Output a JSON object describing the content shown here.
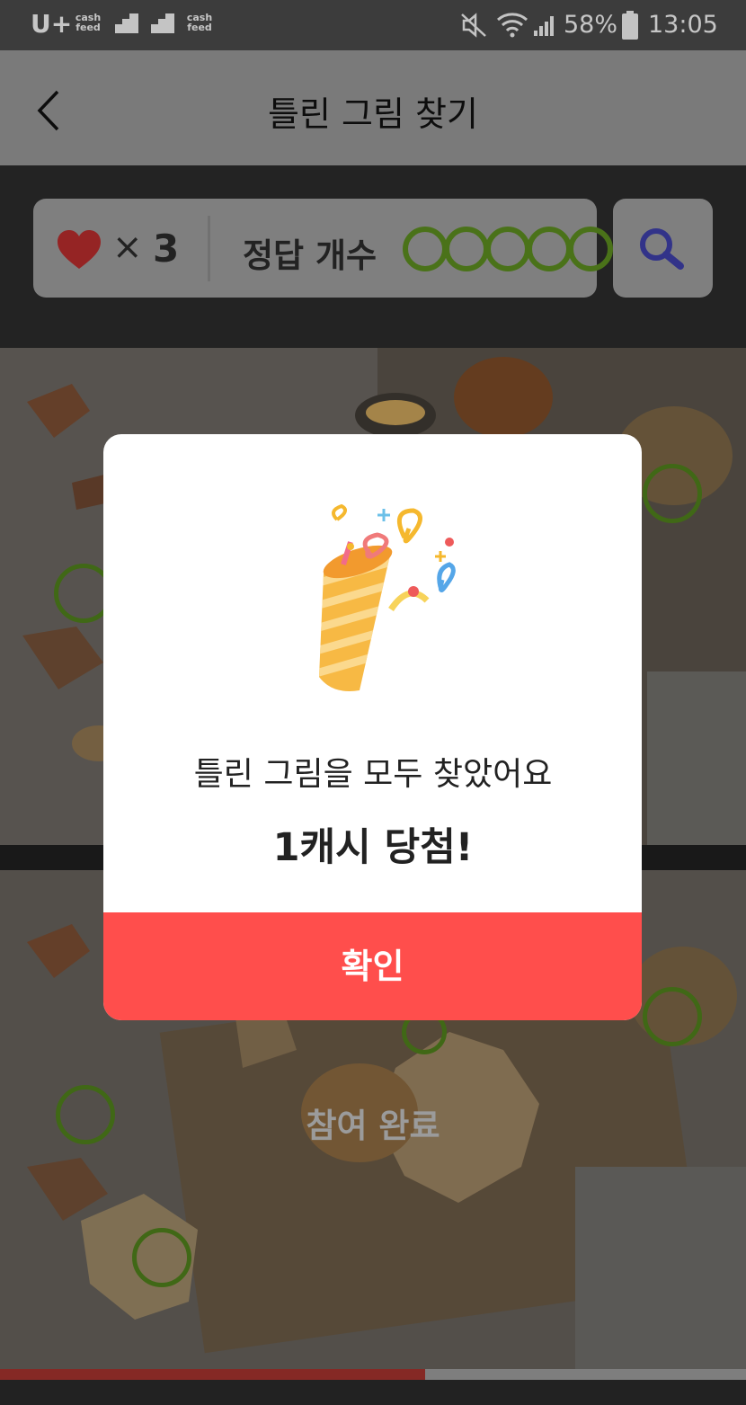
{
  "status_bar": {
    "carrier": "U+",
    "app_badge_1": "cash feed",
    "app_badge_2": "cash feed",
    "battery": "58%",
    "time": "13:05",
    "icons": [
      "mute-icon",
      "wifi-icon",
      "signal-icon",
      "battery-icon"
    ]
  },
  "header": {
    "title": "틀린 그림 찾기",
    "back_icon": "chevron-left-icon"
  },
  "game_status": {
    "lives_times": "×",
    "lives_count": "3",
    "answers_label": "정답 개수",
    "answers_found": 5,
    "answers_total": 5,
    "hint_icon": "search-icon",
    "ring_color": "#5b8c1f"
  },
  "photos": {
    "completed_label": "참여 완료"
  },
  "progress": {
    "fraction": 0.57,
    "fill_color": "#a3332e"
  },
  "modal": {
    "illustration": "party-popper-icon",
    "message": "틀린 그림을 모두 찾았어요",
    "prize": "1캐시 당첨!",
    "confirm_label": "확인",
    "confirm_color": "#ff4e4c"
  }
}
